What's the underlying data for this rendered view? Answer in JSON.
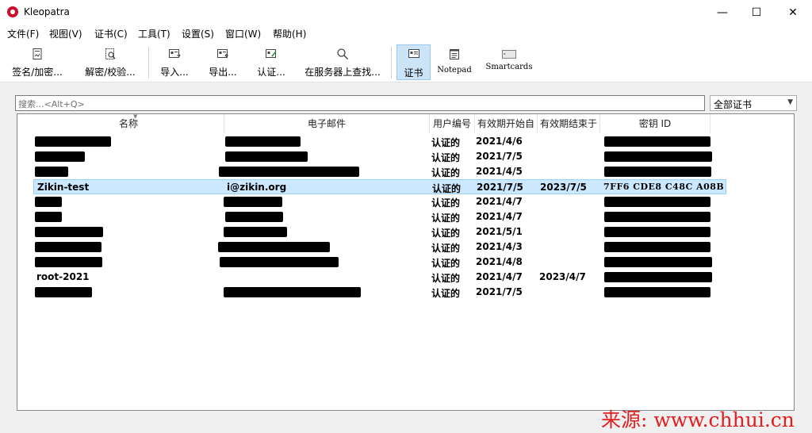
{
  "window": {
    "title": "Kleopatra",
    "minimize": "—",
    "maximize": "☐",
    "close": "✕"
  },
  "menu": [
    "文件(F)",
    "视图(V)",
    "证书(C)",
    "工具(T)",
    "设置(S)",
    "窗口(W)",
    "帮助(H)"
  ],
  "toolbar": {
    "sign_encrypt": "签名/加密...",
    "decrypt_verify": "解密/校验...",
    "import": "导入...",
    "export": "导出...",
    "certify": "认证...",
    "lookup_server": "在服务器上查找...",
    "certificates": "证书",
    "notepad": "Notepad",
    "smartcards": "Smartcards"
  },
  "search": {
    "placeholder": "搜索...<Alt+Q>"
  },
  "filter": {
    "selected": "全部证书"
  },
  "table": {
    "columns": [
      "名称",
      "电子邮件",
      "用户编号",
      "有效期开始自",
      "有效期结束于",
      "密钥 ID"
    ],
    "rows": [
      {
        "name": "",
        "email": "",
        "user_id": "认证的",
        "valid_from": "2021/4/6",
        "valid_until": "",
        "key_id": "",
        "selected": false
      },
      {
        "name": "",
        "email": "",
        "user_id": "认证的",
        "valid_from": "2021/7/5",
        "valid_until": "",
        "key_id": "",
        "selected": false
      },
      {
        "name": "",
        "email": "",
        "user_id": "认证的",
        "valid_from": "2021/4/5",
        "valid_until": "",
        "key_id": "",
        "selected": false
      },
      {
        "name": "Zikin-test",
        "email": "i@zikin.org",
        "user_id": "认证的",
        "valid_from": "2021/7/5",
        "valid_until": "2023/7/5",
        "key_id": "7FF6 CDE8 C48C A08B",
        "selected": true
      },
      {
        "name": "",
        "email": "",
        "user_id": "认证的",
        "valid_from": "2021/4/7",
        "valid_until": "",
        "key_id": "",
        "selected": false
      },
      {
        "name": "",
        "email": "",
        "user_id": "认证的",
        "valid_from": "2021/4/7",
        "valid_until": "",
        "key_id": "",
        "selected": false
      },
      {
        "name": "",
        "email": "",
        "user_id": "认证的",
        "valid_from": "2021/5/1",
        "valid_until": "",
        "key_id": "",
        "selected": false
      },
      {
        "name": "",
        "email": "",
        "user_id": "认证的",
        "valid_from": "2021/4/3",
        "valid_until": "",
        "key_id": "",
        "selected": false
      },
      {
        "name": "",
        "email": "",
        "user_id": "认证的",
        "valid_from": "2021/4/8",
        "valid_until": "",
        "key_id": "",
        "selected": false
      },
      {
        "name": "root-2021",
        "email": "",
        "user_id": "认证的",
        "valid_from": "2021/4/7",
        "valid_until": "2023/4/7",
        "key_id": "",
        "selected": false
      },
      {
        "name": "",
        "email": "",
        "user_id": "认证的",
        "valid_from": "2021/7/5",
        "valid_until": "",
        "key_id": "",
        "selected": false
      }
    ]
  },
  "watermark": "来源: www.chhui.cn",
  "colors": {
    "selection": "#cce8ff",
    "active_tool": "#cce4f7",
    "watermark": "#e02020",
    "app_icon": "#c8102e"
  }
}
